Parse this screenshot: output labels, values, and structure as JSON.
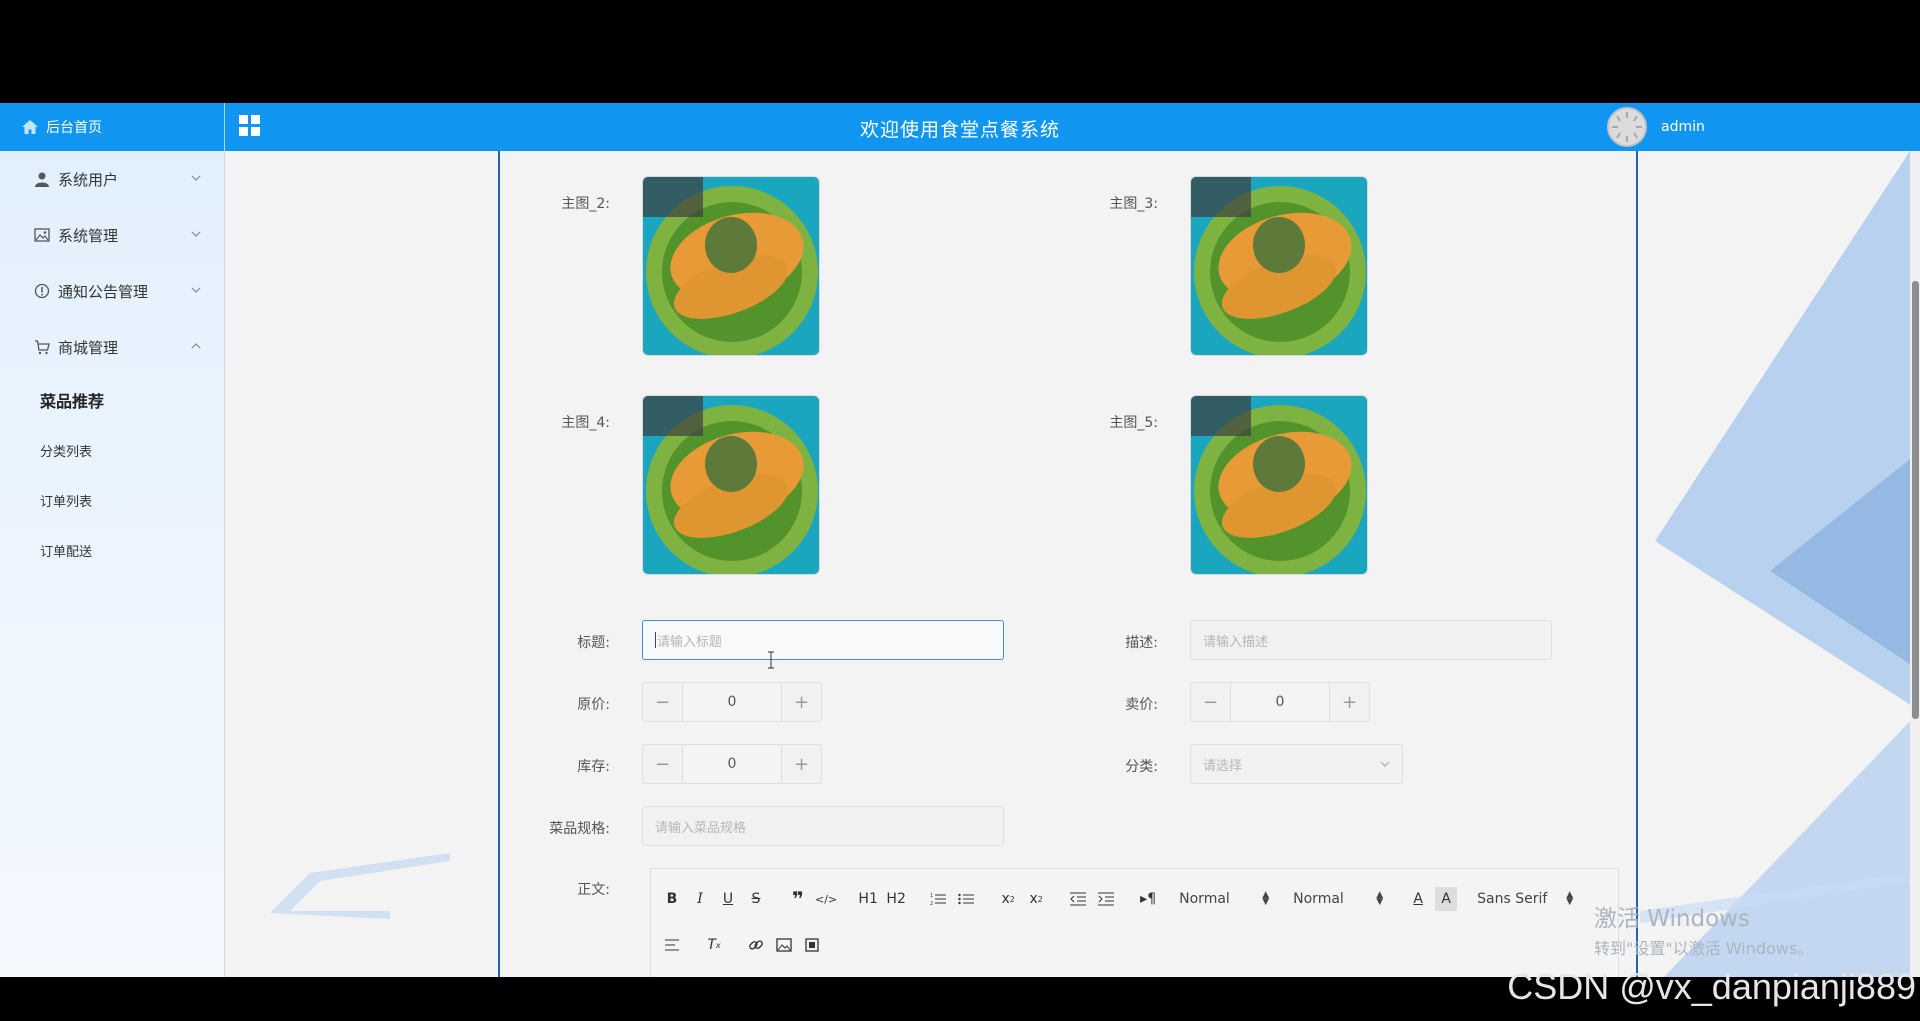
{
  "header": {
    "brand": "后台首页",
    "title": "欢迎使用食堂点餐系统",
    "user": "admin"
  },
  "sidebar": {
    "groups": [
      {
        "label": "系统用户",
        "icon": "user-icon",
        "expanded": false
      },
      {
        "label": "系统管理",
        "icon": "image-icon",
        "expanded": false
      },
      {
        "label": "通知公告管理",
        "icon": "info-circle-icon",
        "expanded": false
      },
      {
        "label": "商城管理",
        "icon": "cart-icon",
        "expanded": true
      }
    ],
    "sub_items": [
      {
        "label": "菜品推荐",
        "active": true
      },
      {
        "label": "分类列表",
        "active": false
      },
      {
        "label": "订单列表",
        "active": false
      },
      {
        "label": "订单配送",
        "active": false
      }
    ]
  },
  "form": {
    "images": [
      {
        "label": "主图_2:"
      },
      {
        "label": "主图_3:"
      },
      {
        "label": "主图_4:"
      },
      {
        "label": "主图_5:"
      }
    ],
    "title_label": "标题:",
    "title_placeholder": "请输入标题",
    "desc_label": "描述:",
    "desc_placeholder": "请输入描述",
    "original_price_label": "原价:",
    "original_price_value": "0",
    "sale_price_label": "卖价:",
    "sale_price_value": "0",
    "stock_label": "库存:",
    "stock_value": "0",
    "category_label": "分类:",
    "category_placeholder": "请选择",
    "spec_label": "菜品规格:",
    "spec_placeholder": "请输入菜品规格",
    "body_label": "正文:"
  },
  "editor": {
    "toolbar": {
      "header_sizes": [
        "H1",
        "H2"
      ],
      "size_select": "Normal",
      "heading_select": "Normal",
      "font_select": "Sans Serif"
    }
  },
  "overlay": {
    "windows_line1": "激活 Windows",
    "windows_line2": "转到\"设置\"以激活 Windows。",
    "watermark": "CSDN @vx_danpianji889"
  },
  "colors": {
    "header": "#1096f0",
    "panel_border": "#1f62b6",
    "focus": "#3b8fdc"
  }
}
